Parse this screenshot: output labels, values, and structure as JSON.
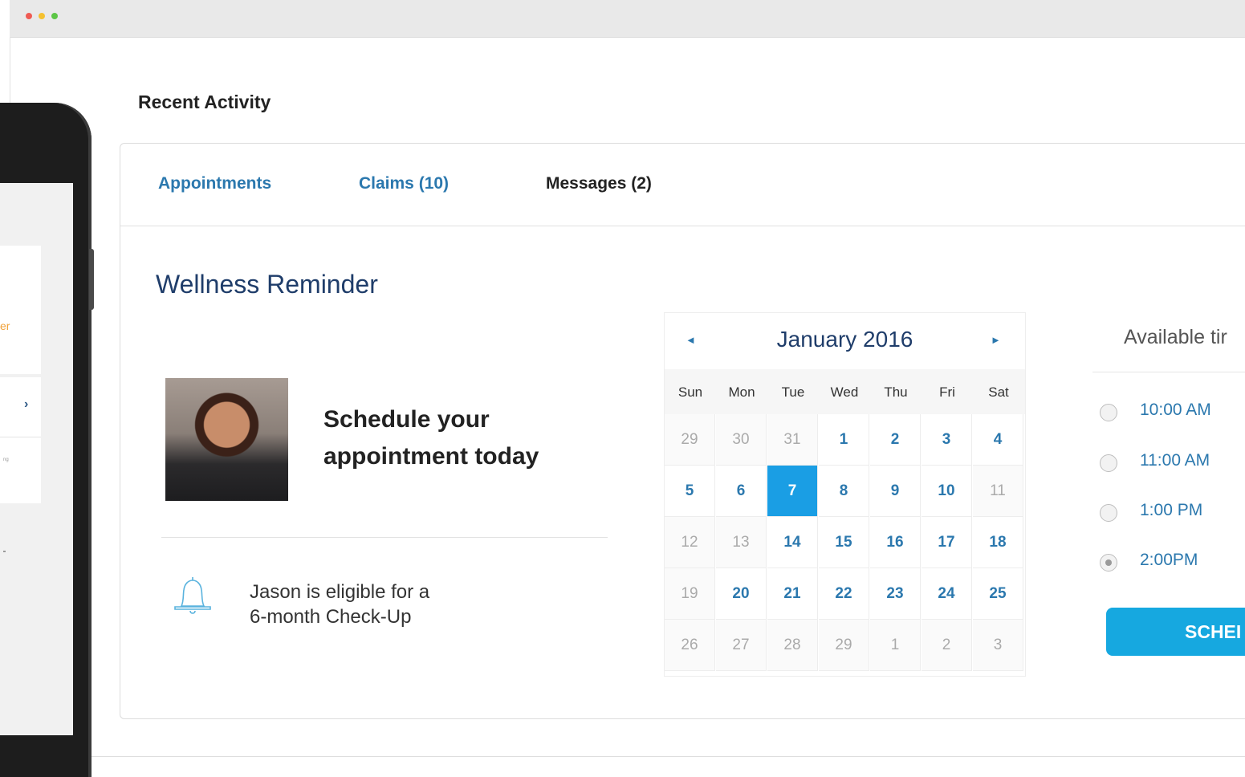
{
  "window": {
    "controls": [
      "close",
      "minimize",
      "zoom"
    ]
  },
  "phone": {
    "visible_text": {
      "er": "er",
      "chevron": "›",
      "tiny": "ng"
    }
  },
  "recent_activity_title": "Recent Activity",
  "tabs": [
    {
      "label": "Appointments",
      "active": false
    },
    {
      "label": "Claims (10)",
      "active": false
    },
    {
      "label": "Messages (2)",
      "active": true
    }
  ],
  "wellness": {
    "title": "Wellness Reminder",
    "schedule_line1": "Schedule your",
    "schedule_line2": "appointment today",
    "eligible_line1": "Jason is eligible for a",
    "eligible_line2": "6-month Check-Up"
  },
  "calendar": {
    "month_label": "January 2016",
    "prev_icon": "◄",
    "next_icon": "►",
    "weekdays": [
      "Sun",
      "Mon",
      "Tue",
      "Wed",
      "Thu",
      "Fri",
      "Sat"
    ],
    "weeks": [
      [
        {
          "d": "29",
          "muted": true
        },
        {
          "d": "30",
          "muted": true
        },
        {
          "d": "31",
          "muted": true
        },
        {
          "d": "1"
        },
        {
          "d": "2"
        },
        {
          "d": "3"
        },
        {
          "d": "4"
        }
      ],
      [
        {
          "d": "5"
        },
        {
          "d": "6"
        },
        {
          "d": "7",
          "selected": true
        },
        {
          "d": "8"
        },
        {
          "d": "9"
        },
        {
          "d": "10"
        },
        {
          "d": "11",
          "muted": true
        }
      ],
      [
        {
          "d": "12",
          "muted": true
        },
        {
          "d": "13",
          "muted": true
        },
        {
          "d": "14"
        },
        {
          "d": "15"
        },
        {
          "d": "16"
        },
        {
          "d": "17"
        },
        {
          "d": "18"
        }
      ],
      [
        {
          "d": "19",
          "muted": true
        },
        {
          "d": "20"
        },
        {
          "d": "21"
        },
        {
          "d": "22"
        },
        {
          "d": "23"
        },
        {
          "d": "24"
        },
        {
          "d": "25"
        }
      ],
      [
        {
          "d": "26",
          "muted": true
        },
        {
          "d": "27",
          "muted": true
        },
        {
          "d": "28",
          "muted": true
        },
        {
          "d": "29",
          "muted": true
        },
        {
          "d": "1",
          "muted": true
        },
        {
          "d": "2",
          "muted": true
        },
        {
          "d": "3",
          "muted": true
        }
      ]
    ]
  },
  "times": {
    "title": "Available tir",
    "slots": [
      {
        "label": "10:00 AM",
        "checked": false
      },
      {
        "label": "11:00 AM",
        "checked": false
      },
      {
        "label": "1:00 PM",
        "checked": false
      },
      {
        "label": "2:00PM",
        "checked": true
      }
    ],
    "button_label": "SCHEI"
  },
  "colors": {
    "accent": "#2b78ae",
    "selected_day": "#1a9ee4",
    "button": "#16a8e0",
    "heading": "#1f3d6a"
  }
}
